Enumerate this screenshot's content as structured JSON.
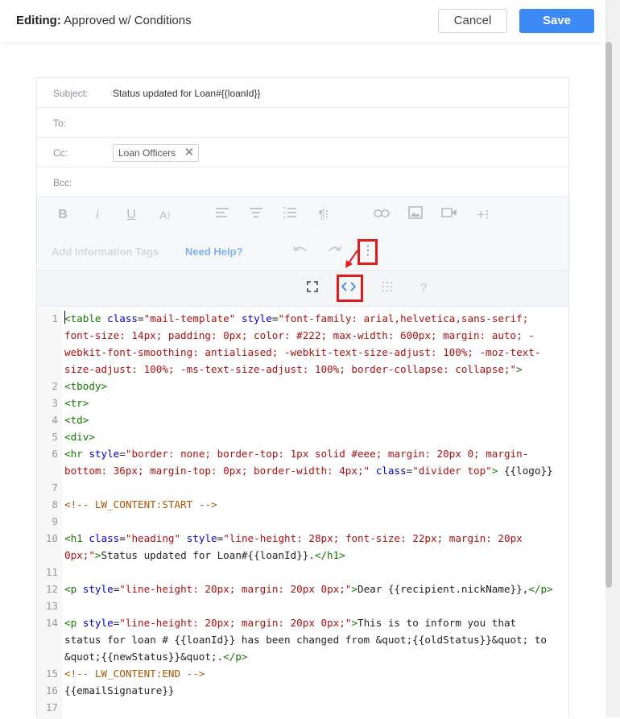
{
  "header": {
    "title_prefix": "Editing:",
    "title_name": "Approved w/ Conditions",
    "cancel_label": "Cancel",
    "save_label": "Save"
  },
  "fields": {
    "subject_label": "Subject:",
    "subject_value": "Status updated for Loan#{{loanId}}",
    "to_label": "To:",
    "cc_label": "Cc:",
    "cc_chip": "Loan Officers",
    "bcc_label": "Bcc:"
  },
  "toolbar": {
    "add_tags_label": "Add Information Tags",
    "need_help_label": "Need Help?",
    "colors": {
      "icon": "#b6bbc2",
      "link": "#7fb0f5",
      "faded": "#d5d8dc",
      "highlight": "#e01b1b",
      "accent": "#3d8af7"
    }
  },
  "code_lines": [
    {
      "n": "1",
      "parts": [
        [
          "t-tag",
          "<table"
        ],
        [
          "t-txt",
          " "
        ],
        [
          "t-attr",
          "class"
        ],
        [
          "t-txt",
          "="
        ],
        [
          "t-str",
          "\"mail-template\""
        ],
        [
          "t-txt",
          " "
        ],
        [
          "t-attr",
          "style"
        ],
        [
          "t-txt",
          "="
        ],
        [
          "t-str",
          "\"font-family: arial,helvetica,sans-serif;"
        ]
      ]
    },
    {
      "n": "",
      "parts": [
        [
          "t-str",
          "font-size: 14px; padding: 0px; color: #222; max-width: 600px; margin: auto; -"
        ]
      ]
    },
    {
      "n": "",
      "parts": [
        [
          "t-str",
          "webkit-font-smoothing: antialiased; -webkit-text-size-adjust: 100%; -moz-text-"
        ]
      ]
    },
    {
      "n": "",
      "parts": [
        [
          "t-str",
          "size-adjust: 100%; -ms-text-size-adjust: 100%; border-collapse: collapse;\""
        ],
        [
          "t-tag",
          ">"
        ]
      ]
    },
    {
      "n": "2",
      "parts": [
        [
          "t-tag",
          "<tbody>"
        ]
      ]
    },
    {
      "n": "3",
      "parts": [
        [
          "t-tag",
          "<tr>"
        ]
      ]
    },
    {
      "n": "4",
      "parts": [
        [
          "t-tag",
          "<td>"
        ]
      ]
    },
    {
      "n": "5",
      "parts": [
        [
          "t-tag",
          "<div>"
        ]
      ]
    },
    {
      "n": "6",
      "parts": [
        [
          "t-tag",
          "<hr"
        ],
        [
          "t-txt",
          " "
        ],
        [
          "t-attr",
          "style"
        ],
        [
          "t-txt",
          "="
        ],
        [
          "t-str",
          "\"border: none; border-top: 1px solid #eee; margin: 20px 0; margin-"
        ]
      ]
    },
    {
      "n": "",
      "parts": [
        [
          "t-str",
          "bottom: 36px; margin-top: 0px; border-width: 4px;\""
        ],
        [
          "t-txt",
          " "
        ],
        [
          "t-attr",
          "class"
        ],
        [
          "t-txt",
          "="
        ],
        [
          "t-str",
          "\"divider top\""
        ],
        [
          "t-tag",
          ">"
        ],
        [
          "t-txt",
          " {{logo}}"
        ]
      ]
    },
    {
      "n": "7",
      "parts": []
    },
    {
      "n": "8",
      "parts": [
        [
          "t-cmt",
          "<!-- LW_CONTENT:START -->"
        ]
      ]
    },
    {
      "n": "9",
      "parts": []
    },
    {
      "n": "10",
      "parts": [
        [
          "t-tag",
          "<h1"
        ],
        [
          "t-txt",
          " "
        ],
        [
          "t-attr",
          "class"
        ],
        [
          "t-txt",
          "="
        ],
        [
          "t-str",
          "\"heading\""
        ],
        [
          "t-txt",
          " "
        ],
        [
          "t-attr",
          "style"
        ],
        [
          "t-txt",
          "="
        ],
        [
          "t-str",
          "\"line-height: 28px; font-size: 22px; margin: 20px"
        ]
      ]
    },
    {
      "n": "",
      "parts": [
        [
          "t-str",
          "0px;\""
        ],
        [
          "t-tag",
          ">"
        ],
        [
          "t-txt",
          "Status updated for Loan#{{loanId}}."
        ],
        [
          "t-tag",
          "</h1>"
        ]
      ]
    },
    {
      "n": "11",
      "parts": []
    },
    {
      "n": "12",
      "parts": [
        [
          "t-tag",
          "<p"
        ],
        [
          "t-txt",
          " "
        ],
        [
          "t-attr",
          "style"
        ],
        [
          "t-txt",
          "="
        ],
        [
          "t-str",
          "\"line-height: 20px; margin: 20px 0px;\""
        ],
        [
          "t-tag",
          ">"
        ],
        [
          "t-txt",
          "Dear {{recipient.nickName}},"
        ],
        [
          "t-tag",
          "</p>"
        ]
      ]
    },
    {
      "n": "13",
      "parts": []
    },
    {
      "n": "14",
      "parts": [
        [
          "t-tag",
          "<p"
        ],
        [
          "t-txt",
          " "
        ],
        [
          "t-attr",
          "style"
        ],
        [
          "t-txt",
          "="
        ],
        [
          "t-str",
          "\"line-height: 20px; margin: 20px 0px;\""
        ],
        [
          "t-tag",
          ">"
        ],
        [
          "t-txt",
          "This is to inform you that"
        ]
      ]
    },
    {
      "n": "",
      "parts": [
        [
          "t-txt",
          "status for loan # {{loanId}} has been changed from &quot;{{oldStatus}}&quot; to"
        ]
      ]
    },
    {
      "n": "",
      "parts": [
        [
          "t-txt",
          "&quot;{{newStatus}}&quot;."
        ],
        [
          "t-tag",
          "</p>"
        ]
      ]
    },
    {
      "n": "15",
      "parts": [
        [
          "t-cmt",
          "<!-- LW_CONTENT:END -->"
        ]
      ]
    },
    {
      "n": "16",
      "parts": [
        [
          "t-txt",
          "{{emailSignature}}"
        ]
      ]
    },
    {
      "n": "17",
      "parts": []
    }
  ]
}
